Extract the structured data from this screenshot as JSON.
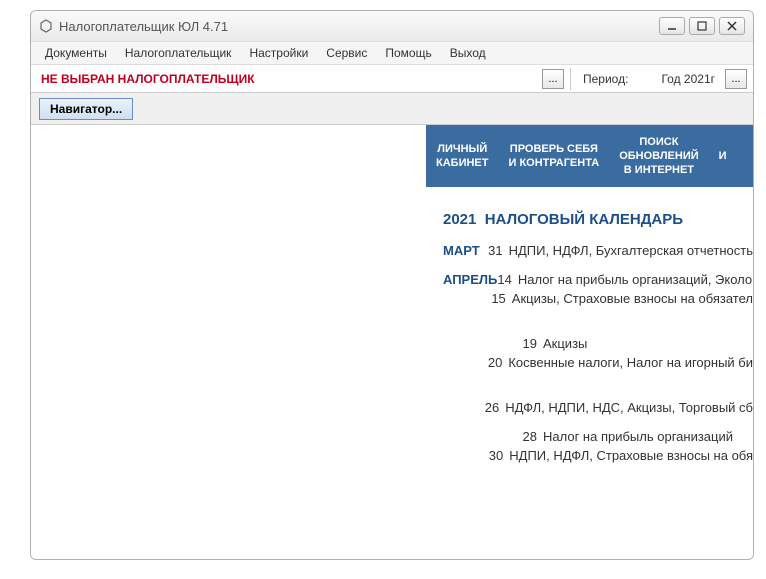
{
  "window": {
    "title": "Налогоплательщик ЮЛ 4.71"
  },
  "menu": {
    "documents": "Документы",
    "taxpayer": "Налогоплательщик",
    "settings": "Настройки",
    "service": "Сервис",
    "help": "Помощь",
    "exit": "Выход"
  },
  "infobar": {
    "warning": "НЕ ВЫБРАН НАЛОГОПЛАТЕЛЬЩИК",
    "ellipsis": "...",
    "period_label": "Период:",
    "period_value": "Год 2021г"
  },
  "navbar": {
    "navigator": "Навигатор..."
  },
  "tabs": {
    "lk": "ЛИЧНЫЙ\nКАБИНЕТ",
    "check": "ПРОВЕРЬ СЕБЯ\nИ КОНТРАГЕНТА",
    "search": "ПОИСК\nОБНОВЛЕНИЙ\nВ ИНТЕРНЕТ",
    "info": "И"
  },
  "calendar": {
    "heading_year": "2021",
    "heading_text": "НАЛОГОВЫЙ КАЛЕНДАРЬ",
    "rows": [
      {
        "month": "МАРТ",
        "day": "31",
        "text": "НДПИ, НДФЛ, Бухгалтерская отчетность"
      },
      {
        "month": "АПРЕЛЬ",
        "day": "14",
        "text": "Налог на прибыль организаций, Эколог"
      },
      {
        "month": "",
        "day": "15",
        "text": "Акцизы, Страховые взносы на обязател"
      },
      {
        "month": "",
        "day": "19",
        "text": "Акцизы"
      },
      {
        "month": "",
        "day": "20",
        "text": "Косвенные налоги, Налог на игорный би"
      },
      {
        "month": "",
        "day": "26",
        "text": "НДФЛ, НДПИ, НДС, Акцизы, Торговый сб"
      },
      {
        "month": "",
        "day": "28",
        "text": "Налог на прибыль организаций"
      },
      {
        "month": "",
        "day": "30",
        "text": "НДПИ, НДФЛ, Страховые взносы на обя"
      }
    ]
  }
}
